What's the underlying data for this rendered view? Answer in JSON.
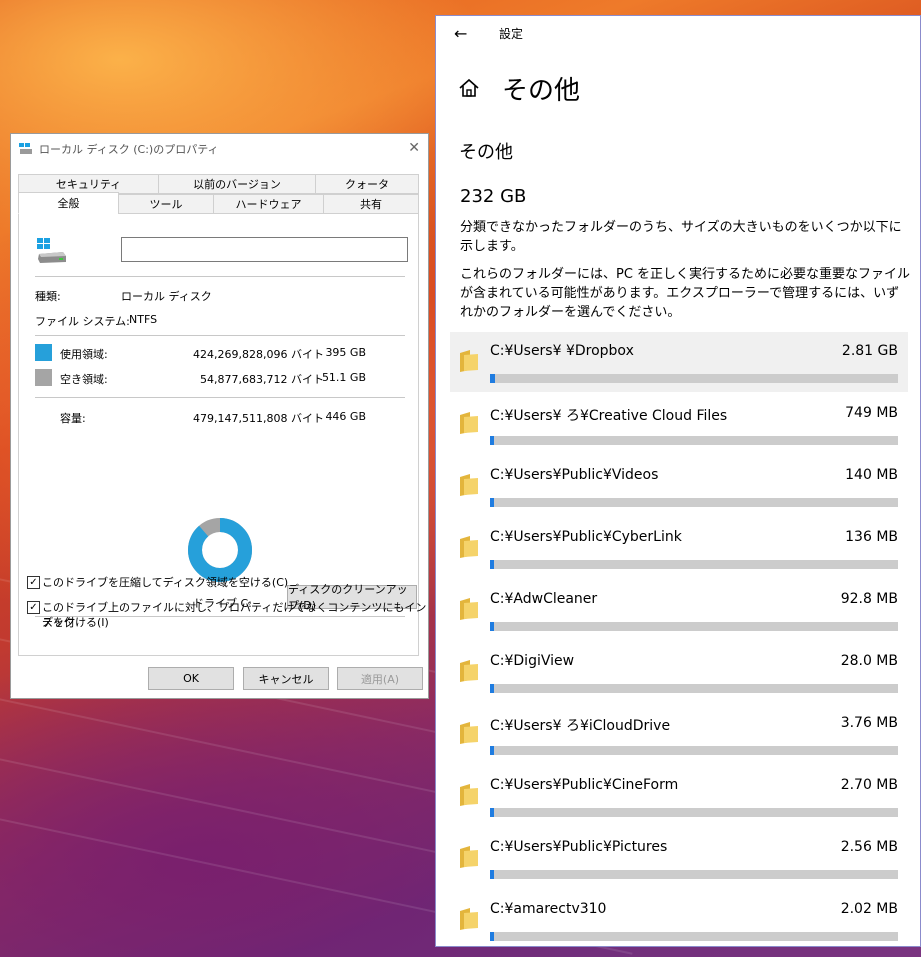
{
  "properties_dialog": {
    "title": "ローカル ディスク (C:)のプロパティ",
    "tabs_row1": [
      "セキュリティ",
      "以前のバージョン",
      "クォータ"
    ],
    "tabs_row2": [
      "全般",
      "ツール",
      "ハードウェア",
      "共有"
    ],
    "active_tab": "全般",
    "type_label": "種類:",
    "type_value": "ローカル ディスク",
    "fs_label": "ファイル システム:",
    "fs_value": "NTFS",
    "used_label": "使用領域:",
    "used_bytes": "424,269,828,096 バイト",
    "used_gb": "395 GB",
    "free_label": "空き領域:",
    "free_bytes": "54,877,683,712 バイト",
    "free_gb": "51.1 GB",
    "capacity_label": "容量:",
    "capacity_bytes": "479,147,511,808 バイト",
    "capacity_gb": "446 GB",
    "used_fraction": 0.885,
    "drive_label": "ドライブ C:",
    "cleanup_button": "ディスクのクリーンアップ(D)",
    "compress_label": "このドライブを圧縮してディスク領域を空ける(C)",
    "index_label_line1": "このドライブ上のファイルに対し、プロパティだけでなくコンテンツにもインデック",
    "index_label_line2": "スを付ける(I)",
    "compress_checked": true,
    "index_checked": true,
    "ok_button": "OK",
    "cancel_button": "キャンセル",
    "apply_button": "適用(A)",
    "colors": {
      "used": "#26a0da",
      "free": "#a5a5a5"
    }
  },
  "settings": {
    "window_label": "設定",
    "title": "その他",
    "subtitle": "その他",
    "total_size": "232 GB",
    "desc1": "分類できなかったフォルダーのうち、サイズの大きいものをいくつか以下に示します。",
    "desc2": "これらのフォルダーには、PC を正しく実行するために必要な重要なファイルが含まれている可能性があります。エクスプローラーで管理するには、いずれかのフォルダーを選んでください。",
    "folders": [
      {
        "path": "C:¥Users¥        ¥Dropbox",
        "size": "2.81 GB",
        "fill": 0.012
      },
      {
        "path": "C:¥Users¥        ろ¥Creative Cloud Files",
        "size": "749 MB",
        "fill": 0.006
      },
      {
        "path": "C:¥Users¥Public¥Videos",
        "size": "140 MB",
        "fill": 0.005
      },
      {
        "path": "C:¥Users¥Public¥CyberLink",
        "size": "136 MB",
        "fill": 0.005
      },
      {
        "path": "C:¥AdwCleaner",
        "size": "92.8 MB",
        "fill": 0.005
      },
      {
        "path": "C:¥DigiView",
        "size": "28.0 MB",
        "fill": 0.005
      },
      {
        "path": "C:¥Users¥        ろ¥iCloudDrive",
        "size": "3.76 MB",
        "fill": 0.005
      },
      {
        "path": "C:¥Users¥Public¥CineForm",
        "size": "2.70 MB",
        "fill": 0.005
      },
      {
        "path": "C:¥Users¥Public¥Pictures",
        "size": "2.56 MB",
        "fill": 0.005
      },
      {
        "path": "C:¥amarectv310",
        "size": "2.02 MB",
        "fill": 0.005
      }
    ],
    "colors": {
      "bar_fill": "#1f7ce0",
      "bar_track": "#cccccc",
      "folder": "#f0c84a"
    }
  }
}
